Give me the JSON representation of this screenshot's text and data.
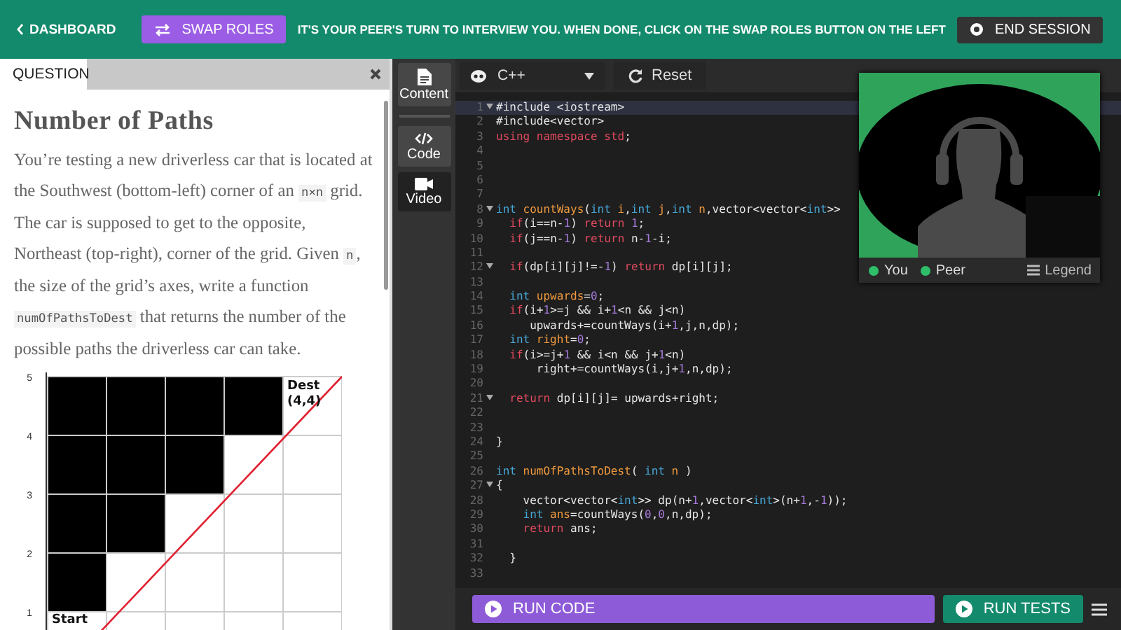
{
  "header": {
    "back_link": "DASHBOARD",
    "swap_button": "SWAP ROLES",
    "message": "IT'S YOUR PEER'S TURN TO INTERVIEW YOU. WHEN DONE, CLICK ON THE SWAP ROLES BUTTON ON THE LEFT",
    "end_button": "END SESSION"
  },
  "question_panel": {
    "tab": "QUESTION",
    "title": "Number of Paths",
    "paragraph": [
      {
        "kind": "text",
        "text": "You’re testing a new driverless car that is located at the Southwest (bottom-left) corner of an "
      },
      {
        "kind": "code",
        "text": "n×n"
      },
      {
        "kind": "text",
        "text": " grid. The car is supposed to get to the opposite, Northeast (top-right), corner of the grid. Given "
      },
      {
        "kind": "code",
        "text": "n"
      },
      {
        "kind": "text",
        "text": ", the size of the grid’s axes, write a function "
      },
      {
        "kind": "code",
        "text": "numOfPathsToDest"
      },
      {
        "kind": "text",
        "text": " that returns the number of the possible paths the driverless car can take."
      }
    ],
    "figure": {
      "y_ticks": [
        "5",
        "4",
        "3",
        "2",
        "1"
      ],
      "dest_label": [
        "Dest",
        "(4,4)"
      ],
      "start_label": "Start"
    }
  },
  "side_tabs": [
    {
      "label": "Content",
      "kind": "document",
      "selected": true
    },
    {
      "label": "Code",
      "kind": "code",
      "selected": true
    },
    {
      "label": "Video",
      "kind": "camera",
      "selected": false
    }
  ],
  "editor": {
    "language": "C++",
    "reset_button": "Reset",
    "lines": [
      {
        "n": "1",
        "text": "#include <iostream>",
        "fold": true,
        "active": true
      },
      {
        "n": "2",
        "text": "#include<vector>",
        "fold": false,
        "active": false
      },
      {
        "n": "3",
        "text": "using namespace std;",
        "fold": false,
        "active": false
      },
      {
        "n": "4",
        "fold": false,
        "active": false
      },
      {
        "n": "5",
        "fold": false,
        "active": false
      },
      {
        "n": "6",
        "fold": false,
        "active": false
      },
      {
        "n": "7",
        "fold": false,
        "active": false
      },
      {
        "n": "8",
        "text": "int countWays(int i,int j,int n,vector<vector<int>>",
        "fold": true,
        "active": false
      },
      {
        "n": "9",
        "text": "  if(i==n-1) return 1;",
        "fold": false,
        "active": false
      },
      {
        "n": "10",
        "text": "  if(j==n-1) return n-1-i;",
        "fold": false,
        "active": false
      },
      {
        "n": "11",
        "fold": false,
        "active": false
      },
      {
        "n": "12",
        "text": "  if(dp[i][j]!=-1) return dp[i][j];",
        "fold": true,
        "active": false
      },
      {
        "n": "13",
        "fold": false,
        "active": false
      },
      {
        "n": "14",
        "text": "  int upwards=0;",
        "fold": false,
        "active": false
      },
      {
        "n": "15",
        "text": "  if(i+1>=j && i+1<n && j<n)",
        "fold": false,
        "active": false
      },
      {
        "n": "16",
        "text": "     upwards+=countWays(i+1,j,n,dp);",
        "fold": false,
        "active": false
      },
      {
        "n": "17",
        "text": "  int right=0;",
        "fold": false,
        "active": false
      },
      {
        "n": "18",
        "text": "  if(i>=j+1 && i<n && j+1<n)",
        "fold": false,
        "active": false
      },
      {
        "n": "19",
        "text": "      right+=countWays(i,j+1,n,dp);",
        "fold": false,
        "active": false
      },
      {
        "n": "20",
        "fold": false,
        "active": false
      },
      {
        "n": "21",
        "text": "  return dp[i][j]= upwards+right;",
        "fold": true,
        "active": false
      },
      {
        "n": "22",
        "fold": false,
        "active": false
      },
      {
        "n": "23",
        "fold": false,
        "active": false
      },
      {
        "n": "24",
        "text": "}",
        "fold": false,
        "active": false
      },
      {
        "n": "25",
        "fold": false,
        "active": false
      },
      {
        "n": "26",
        "text": "int numOfPathsToDest( int n )",
        "fold": false,
        "active": false
      },
      {
        "n": "27",
        "text": "{",
        "fold": true,
        "active": false
      },
      {
        "n": "28",
        "text": "    vector<vector<int>> dp(n+1,vector<int>(n+1,-1));",
        "fold": false,
        "active": false
      },
      {
        "n": "29",
        "text": "    int ans=countWays(0,0,n,dp);",
        "fold": false,
        "active": false
      },
      {
        "n": "30",
        "text": "    return ans;",
        "fold": false,
        "active": false
      },
      {
        "n": "31",
        "fold": false,
        "active": false
      },
      {
        "n": "32",
        "text": "  }",
        "fold": false,
        "active": false
      },
      {
        "n": "33",
        "fold": false,
        "active": false
      }
    ],
    "run_code_button": "RUN CODE",
    "run_tests_button": "RUN TESTS"
  },
  "video": {
    "legend": [
      {
        "label": "You",
        "color": "#2fbf6a"
      },
      {
        "label": "Peer",
        "color": "#2fbf6a"
      }
    ],
    "legend_button": "Legend"
  }
}
